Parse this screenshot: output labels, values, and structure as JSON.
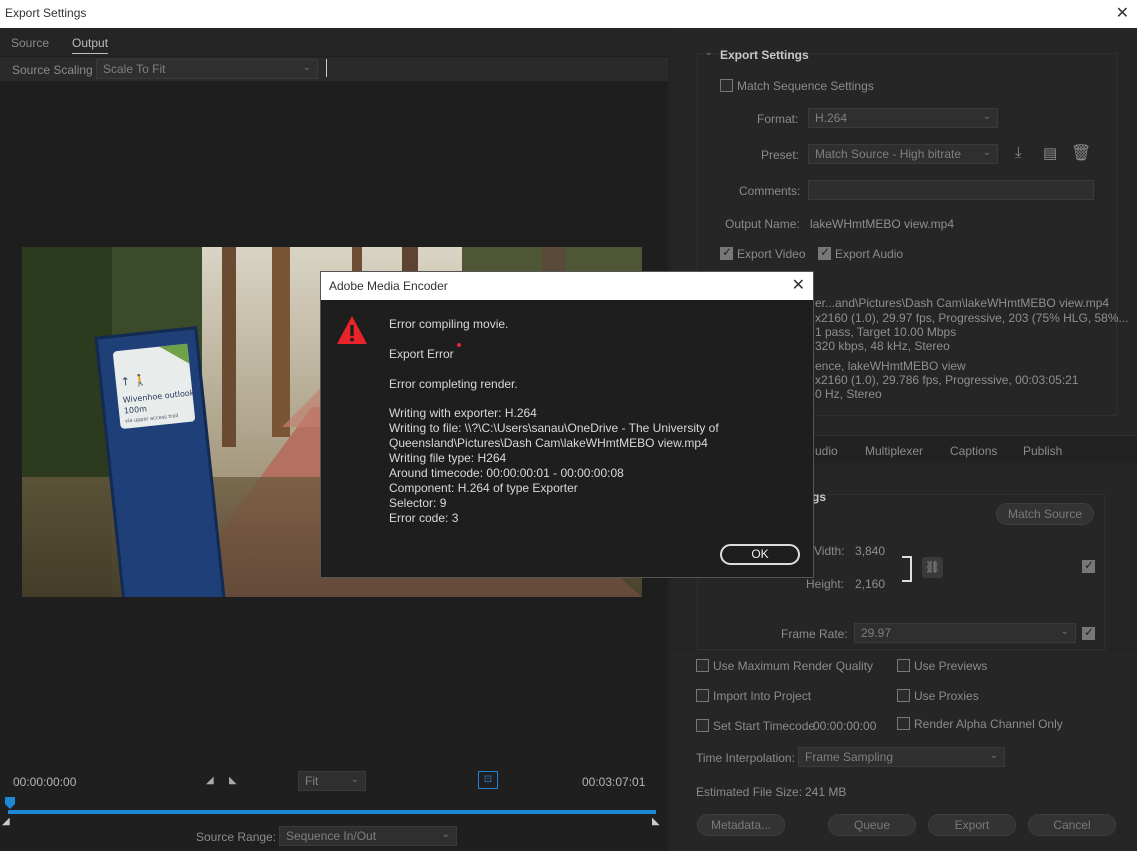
{
  "window": {
    "title": "Export Settings"
  },
  "left": {
    "tabs": [
      "Source",
      "Output"
    ],
    "source_scaling_label": "Source Scaling",
    "source_scaling_value": "Scale To Fit",
    "preview": {
      "sign_title": "Wivenhoe outlook",
      "sign_distance": "100m",
      "sign_sub": "via upper access trail"
    },
    "timecode_start": "00:00:00:00",
    "timecode_end": "00:03:07:01",
    "zoom_value": "Fit",
    "source_range_label": "Source Range:",
    "source_range_value": "Sequence In/Out"
  },
  "right": {
    "section_title": "Export Settings",
    "match_sequence": "Match Sequence Settings",
    "format_label": "Format:",
    "format_value": "H.264",
    "preset_label": "Preset:",
    "preset_value": "Match Source - High bitrate",
    "comments_label": "Comments:",
    "output_name_label": "Output Name:",
    "output_name_value": "lakeWHmtMEBO view.mp4",
    "export_video": "Export Video",
    "export_audio": "Export Audio",
    "summary_lines": [
      "er...and\\Pictures\\Dash Cam\\lakeWHmtMEBO view.mp4",
      "x2160 (1.0), 29.97 fps, Progressive, 203 (75% HLG, 58%...",
      "1 pass, Target 10.00 Mbps",
      "320 kbps, 48 kHz, Stereo",
      "ence, lakeWHmtMEBO view",
      "x2160 (1.0), 29.786 fps, Progressive, 00:03:05:21",
      "0 Hz, Stereo"
    ],
    "tabs": [
      "udio",
      "Multiplexer",
      "Captions",
      "Publish"
    ],
    "video_section_title": "gs",
    "match_source_button": "Match Source",
    "width_label": "Vidth:",
    "width_value": "3,840",
    "height_label": "Height:",
    "height_value": "2,160",
    "frame_rate_label": "Frame Rate:",
    "frame_rate_value": "29.97",
    "options": {
      "max_render": "Use Maximum Render Quality",
      "use_previews": "Use Previews",
      "import_project": "Import Into Project",
      "use_proxies": "Use Proxies",
      "set_start_tc": "Set Start Timecode",
      "start_tc_value": "00:00:00:00",
      "render_alpha": "Render Alpha Channel Only"
    },
    "time_interp_label": "Time Interpolation:",
    "time_interp_value": "Frame Sampling",
    "est_size_label": "Estimated File Size:",
    "est_size_value": "241 MB",
    "buttons": {
      "metadata": "Metadata...",
      "queue": "Queue",
      "export": "Export",
      "cancel": "Cancel"
    }
  },
  "dialog": {
    "title": "Adobe Media Encoder",
    "line1": "Error compiling movie.",
    "line2": "Export Error",
    "line3": "Error completing render.",
    "details": [
      "Writing with exporter: H.264",
      "Writing to file: \\\\?\\C:\\Users\\sanau\\OneDrive - The University of",
      "Queensland\\Pictures\\Dash Cam\\lakeWHmtMEBO view.mp4",
      "Writing file type: H264",
      "Around timecode: 00:00:00:01 - 00:00:00:08",
      "Component: H.264 of type Exporter",
      "Selector: 9",
      "Error code: 3"
    ],
    "ok": "OK",
    "icon_color": "#e8232a"
  }
}
